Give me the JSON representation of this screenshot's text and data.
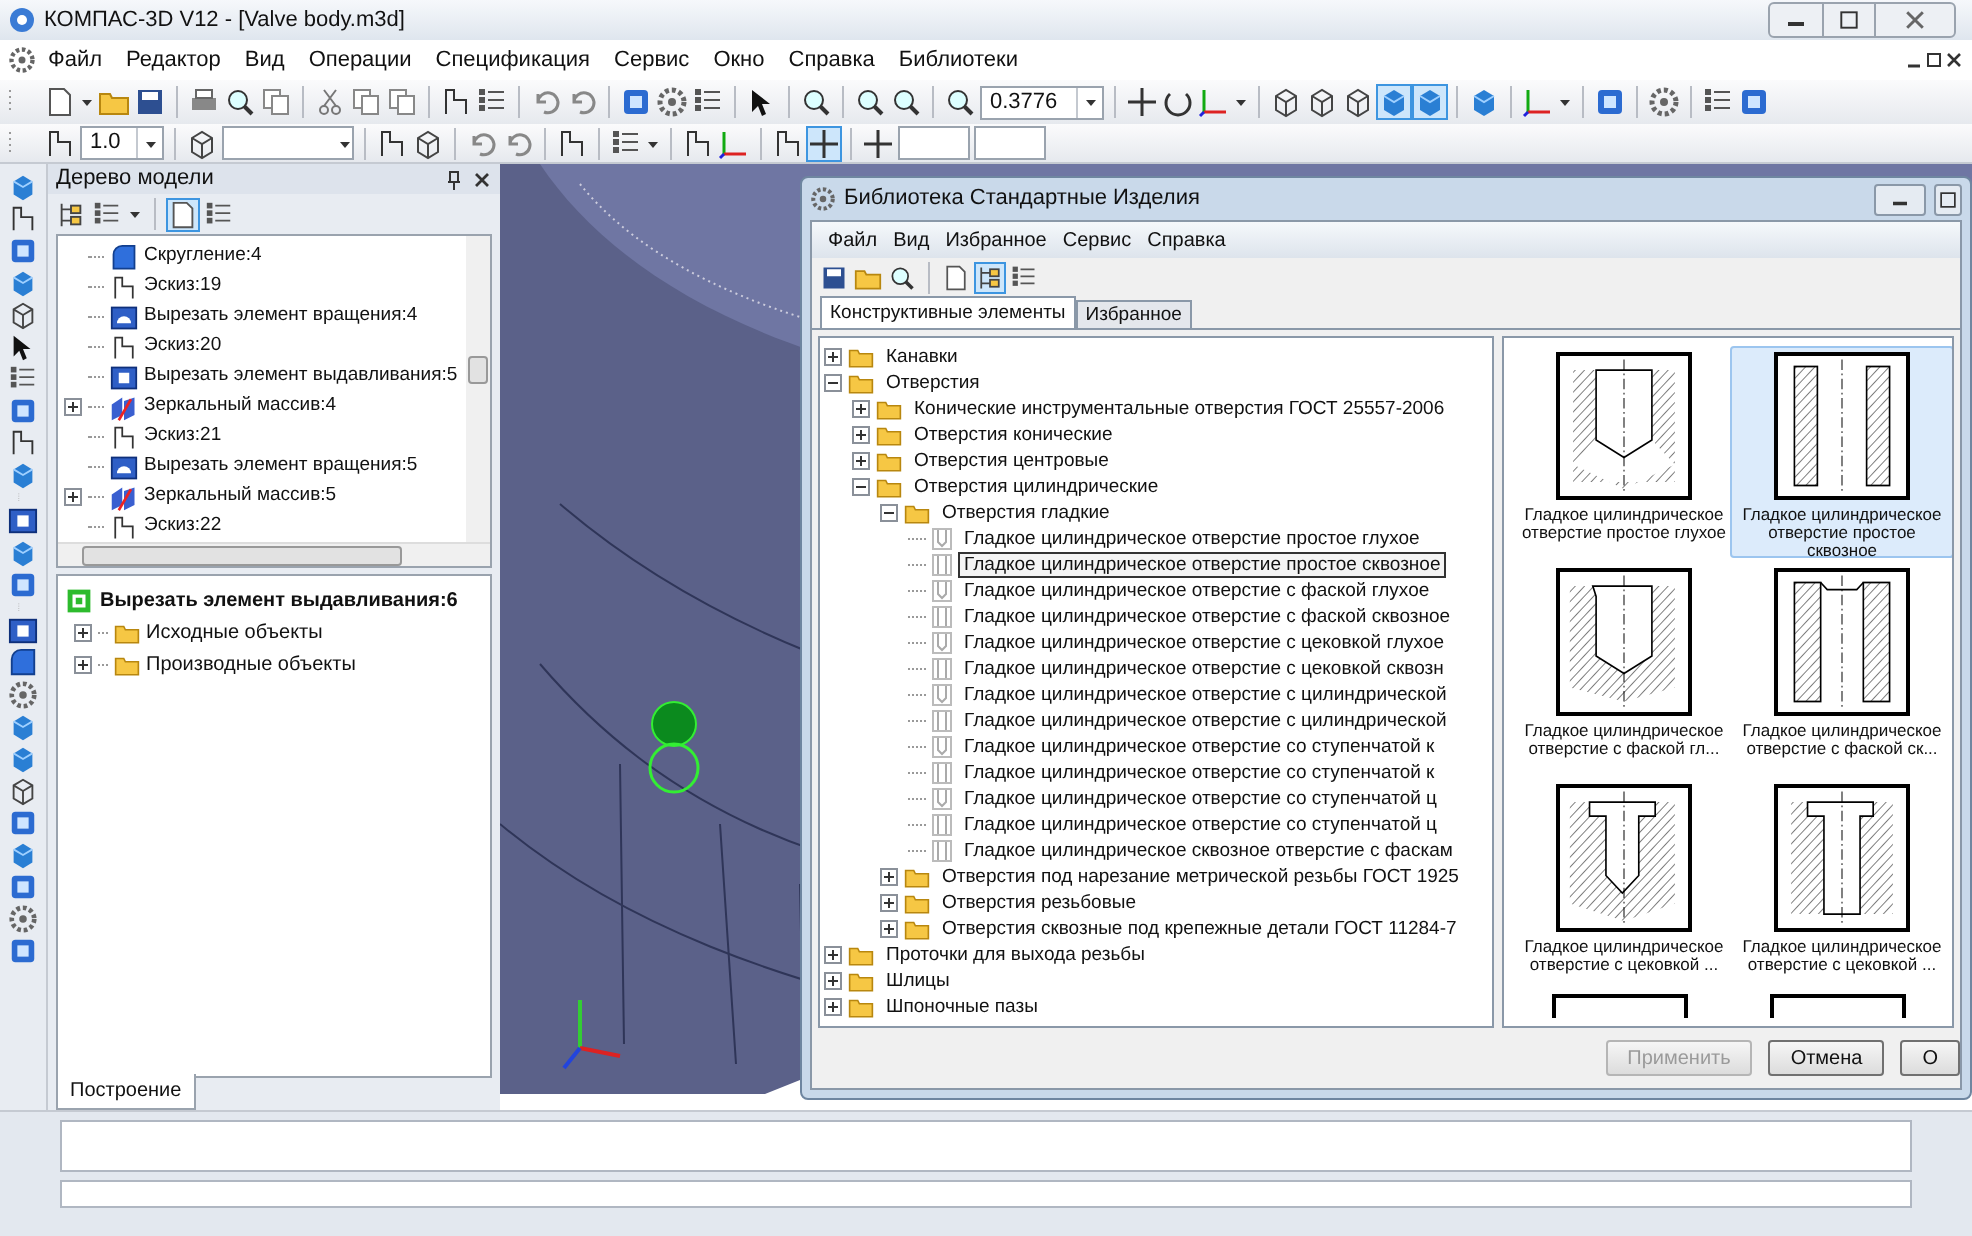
{
  "window": {
    "title": "КОМПАС-3D V12 - [Valve body.m3d]"
  },
  "menu": [
    "Файл",
    "Редактор",
    "Вид",
    "Операции",
    "Спецификация",
    "Сервис",
    "Окно",
    "Справка",
    "Библиотеки"
  ],
  "toolbar": {
    "zoom": "0.3776",
    "line_step": "1.0",
    "view_modes": [
      {
        "selected": false
      },
      {
        "selected": false
      },
      {
        "selected": false
      },
      {
        "selected": true
      },
      {
        "selected": true
      }
    ],
    "snap": {
      "selected": true
    }
  },
  "model_tree": {
    "title": "Дерево модели",
    "toolbar": [
      {
        "selected": false
      },
      {
        "selected": false
      },
      {
        "selected": true
      },
      {
        "selected": false
      }
    ],
    "items": [
      {
        "label": "Скругление:4",
        "kind": "fillet",
        "expandable": false
      },
      {
        "label": "Эскиз:19",
        "kind": "sketch",
        "expandable": false
      },
      {
        "label": "Вырезать элемент вращения:4",
        "kind": "revolve_cut",
        "expandable": false
      },
      {
        "label": "Эскиз:20",
        "kind": "sketch",
        "expandable": false
      },
      {
        "label": "Вырезать элемент выдавливания:5",
        "kind": "extrude_cut",
        "expandable": false
      },
      {
        "label": "Зеркальный массив:4",
        "kind": "mirror",
        "expandable": true
      },
      {
        "label": "Эскиз:21",
        "kind": "sketch",
        "expandable": false
      },
      {
        "label": "Вырезать элемент вращения:5",
        "kind": "revolve_cut",
        "expandable": false
      },
      {
        "label": "Зеркальный массив:5",
        "kind": "mirror",
        "expandable": true
      },
      {
        "label": "Эскиз:22",
        "kind": "sketch",
        "expandable": false
      }
    ],
    "detail": {
      "label": "Вырезать элемент выдавливания:6",
      "children": [
        {
          "label": "Исходные объекты",
          "expanded": false
        },
        {
          "label": "Производные объекты",
          "expanded": false
        }
      ]
    },
    "tab": "Построение"
  },
  "library": {
    "title": "Библиотека Стандартные Изделия",
    "menu": [
      "Файл",
      "Вид",
      "Избранное",
      "Сервис",
      "Справка"
    ],
    "toolbar": [
      {
        "selected": false
      },
      {
        "selected": false
      },
      {
        "selected": false
      },
      {
        "selected": false
      },
      {
        "selected": true
      },
      {
        "selected": false
      }
    ],
    "tabs": [
      {
        "label": "Конструктивные элементы",
        "selected": true
      },
      {
        "label": "Избранное",
        "selected": false
      }
    ],
    "tree": [
      {
        "label": "Канавки",
        "kind": "folder",
        "expanded": false,
        "selected": false
      },
      {
        "label": "Отверстия",
        "kind": "folder",
        "expanded": true,
        "selected": false,
        "children": [
          {
            "label": "Конические инструментальные отверстия ГОСТ 25557-2006",
            "kind": "folder",
            "expanded": false,
            "selected": false
          },
          {
            "label": "Отверстия конические",
            "kind": "folder",
            "expanded": false,
            "selected": false
          },
          {
            "label": "Отверстия центровые",
            "kind": "folder",
            "expanded": false,
            "selected": false
          },
          {
            "label": "Отверстия цилиндрические",
            "kind": "folder",
            "expanded": true,
            "selected": false,
            "children": [
              {
                "label": "Отверстия гладкие",
                "kind": "folder",
                "expanded": true,
                "selected": false,
                "children": [
                  {
                    "label": "Гладкое цилиндрическое отверстие простое глухое",
                    "kind": "blind",
                    "selected": false
                  },
                  {
                    "label": "Гладкое цилиндрическое отверстие простое сквозное",
                    "kind": "through",
                    "selected": true
                  },
                  {
                    "label": "Гладкое цилиндрическое отверстие с фаской глухое",
                    "kind": "blind",
                    "selected": false
                  },
                  {
                    "label": "Гладкое цилиндрическое отверстие с фаской сквозное",
                    "kind": "through",
                    "selected": false
                  },
                  {
                    "label": "Гладкое цилиндрическое отверстие с цековкой глухое",
                    "kind": "blind",
                    "selected": false
                  },
                  {
                    "label": "Гладкое цилиндрическое отверстие с цековкой сквозн",
                    "kind": "through",
                    "selected": false
                  },
                  {
                    "label": "Гладкое цилиндрическое отверстие с цилиндрической",
                    "kind": "blind",
                    "selected": false
                  },
                  {
                    "label": "Гладкое цилиндрическое отверстие с цилиндрической",
                    "kind": "through",
                    "selected": false
                  },
                  {
                    "label": "Гладкое цилиндрическое отверстие со ступенчатой к",
                    "kind": "blind",
                    "selected": false
                  },
                  {
                    "label": "Гладкое цилиндрическое отверстие со ступенчатой к",
                    "kind": "through",
                    "selected": false
                  },
                  {
                    "label": "Гладкое цилиндрическое отверстие со ступенчатой ц",
                    "kind": "blind",
                    "selected": false
                  },
                  {
                    "label": "Гладкое цилиндрическое отверстие со ступенчатой ц",
                    "kind": "through",
                    "selected": false
                  },
                  {
                    "label": "Гладкое цилиндрическое сквозное отверстие с фаскам",
                    "kind": "through",
                    "selected": false
                  }
                ]
              },
              {
                "label": "Отверстия под нарезание метрической резьбы ГОСТ 1925",
                "kind": "folder",
                "expanded": false,
                "selected": false
              },
              {
                "label": "Отверстия резьбовые",
                "kind": "folder",
                "expanded": false,
                "selected": false
              },
              {
                "label": "Отверстия сквозные под крепежные детали ГОСТ 11284-7",
                "kind": "folder",
                "expanded": false,
                "selected": false
              }
            ]
          }
        ]
      },
      {
        "label": "Проточки для выхода резьбы",
        "kind": "folder",
        "expanded": false,
        "selected": false
      },
      {
        "label": "Шлицы",
        "kind": "folder",
        "expanded": false,
        "selected": false
      },
      {
        "label": "Шпоночные пазы",
        "kind": "folder",
        "expanded": false,
        "selected": false
      }
    ],
    "previews": [
      {
        "caption": "Гладкое цилиндрическое отверстие простое глухое",
        "kind": "blind",
        "selected": false
      },
      {
        "caption": "Гладкое цилиндрическое отверстие простое сквозное",
        "kind": "through",
        "selected": true
      },
      {
        "caption": "Гладкое цилиндрическое отверстие с фаской гл...",
        "kind": "chamfer_blind",
        "selected": false
      },
      {
        "caption": "Гладкое цилиндрическое отверстие с фаской ск...",
        "kind": "chamfer_through",
        "selected": false
      },
      {
        "caption": "Гладкое цилиндрическое отверстие с цековкой ...",
        "kind": "counterbore_blind",
        "selected": false
      },
      {
        "caption": "Гладкое цилиндрическое отверстие с цековкой ...",
        "kind": "counterbore_through",
        "selected": false
      }
    ],
    "buttons": [
      {
        "label": "Применить",
        "disabled": true
      },
      {
        "label": "Отмена",
        "disabled": false
      },
      {
        "label": "О",
        "disabled": false
      }
    ]
  }
}
